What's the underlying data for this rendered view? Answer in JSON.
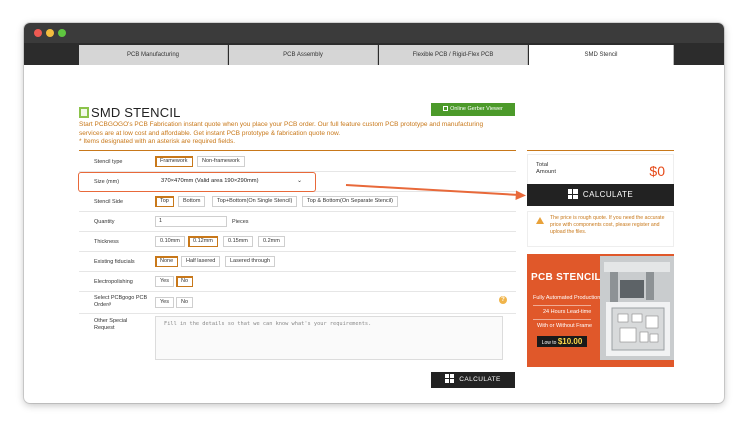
{
  "window": {
    "tabs": [
      {
        "label": "PCB Manufacturing",
        "active": false
      },
      {
        "label": "PCB Assembly",
        "active": false
      },
      {
        "label": "Flexible PCB / Rigid-Flex PCB",
        "active": false
      },
      {
        "label": "SMD Stencil",
        "active": true
      }
    ]
  },
  "header": {
    "title": "SMD STENCIL",
    "gerber_button": "Online Gerber Viewer",
    "intro": "Start PCBGOGO's PCB Fabrication instant quote when you place your PCB order. Our full feature custom PCB prototype and manufacturing services are at low cost and affordable. Get instant PCB prototype & fabrication quote now.",
    "required_note": "* Items designated with an asterisk are required fields."
  },
  "form": {
    "stencil_type": {
      "label": "Stencil type",
      "options": [
        "Framework",
        "Non-framework"
      ],
      "selected": "Framework"
    },
    "size": {
      "label": "Size (mm)",
      "value": "370×470mm  (Valid area  190×290mm)"
    },
    "stencil_side": {
      "label": "Stencil Side",
      "options": [
        "Top",
        "Bottom",
        "Top+Bottom(On Single Stencil)",
        "Top & Bottom(On Separate Stencil)"
      ],
      "selected": "Top"
    },
    "quantity": {
      "label": "Quantity",
      "value": "1",
      "unit": "Pieces"
    },
    "thickness": {
      "label": "Thickness",
      "options": [
        "0.10mm",
        "0.12mm",
        "0.15mm",
        "0.2mm"
      ],
      "selected": "0.12mm"
    },
    "fiducials": {
      "label": "Existing fiducials",
      "options": [
        "None",
        "Half lasered",
        "Lasered through"
      ],
      "selected": "None"
    },
    "electropolishing": {
      "label": "Electropolishing",
      "options": [
        "Yes",
        "No"
      ],
      "selected": "No"
    },
    "pcb_order": {
      "label": "Select PCBgogo PCB Order#",
      "options": [
        "Yes",
        "No"
      ]
    },
    "special": {
      "label": "Other Special Request",
      "placeholder": "Fill in the details so that we can know what's your requirements."
    },
    "calculate_label": "CALCULATE"
  },
  "sidebar": {
    "total_label": "Total Amount",
    "total_value": "$0",
    "calculate_label": "CALCULATE",
    "notice": "The price is rough quote. If you need the accurate price with components cost, please register and upload the files."
  },
  "banner": {
    "title": "PCB STENCIL",
    "line1": "Fully Automated Production",
    "line2": "24 Hours Lead-time",
    "line3": "With or Without Frame",
    "price_prefix": "Low to",
    "price": "$10.00"
  },
  "colors": {
    "accent": "#c8781a",
    "arrow": "#e8693a",
    "green_button": "#4c9a2a",
    "banner": "#e0582a"
  }
}
